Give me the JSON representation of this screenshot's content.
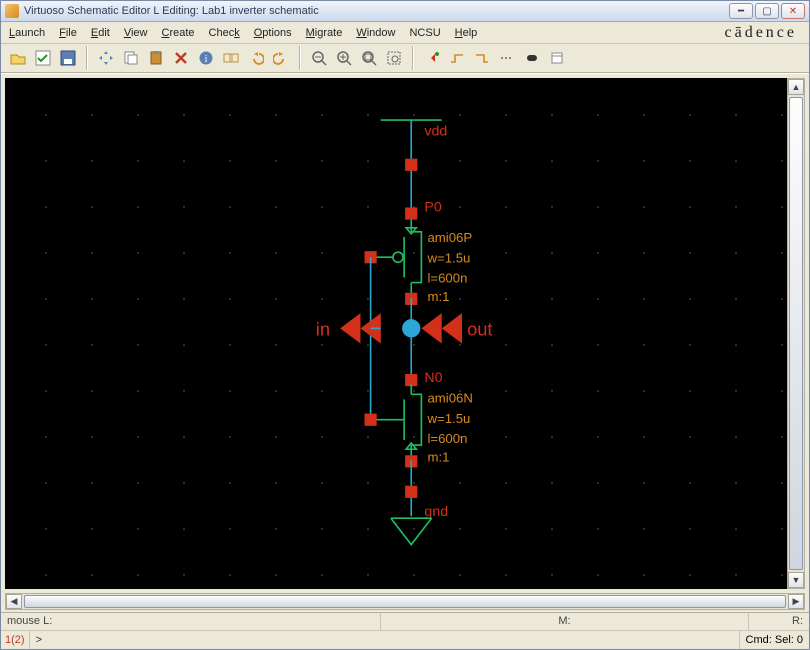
{
  "window": {
    "title": "Virtuoso Schematic Editor L Editing: Lab1 inverter schematic"
  },
  "menu": {
    "items": [
      "Launch",
      "File",
      "Edit",
      "View",
      "Create",
      "Check",
      "Options",
      "Migrate",
      "Window",
      "NCSU",
      "Help"
    ]
  },
  "brand": "cādence",
  "status": {
    "mouse_left": "mouse L:",
    "mouse_mid": "M:",
    "mouse_right": "R:",
    "linecol": "1(2)",
    "prompt": ">",
    "cmd": "Cmd: Sel: 0"
  },
  "schematic": {
    "nets": {
      "vdd": "vdd",
      "gnd": "gnd"
    },
    "pins": {
      "in": "in",
      "out": "out"
    },
    "devices": {
      "pmos": {
        "inst": "P0",
        "model": "ami06P",
        "w": "w=1.5u",
        "l": "l=600n",
        "m": "m:1"
      },
      "nmos": {
        "inst": "N0",
        "model": "ami06N",
        "w": "w=1.5u",
        "l": "l=600n",
        "m": "m:1"
      }
    }
  },
  "toolbar_icons": [
    "open",
    "check",
    "save",
    "sep",
    "move",
    "copy",
    "paste-special",
    "delete",
    "info",
    "group",
    "undo",
    "redo",
    "sep",
    "zoom-out",
    "zoom-in",
    "zoom-fit",
    "zoom-sel",
    "sep",
    "pin",
    "wire-h",
    "wire-v",
    "label",
    "instance",
    "net"
  ]
}
